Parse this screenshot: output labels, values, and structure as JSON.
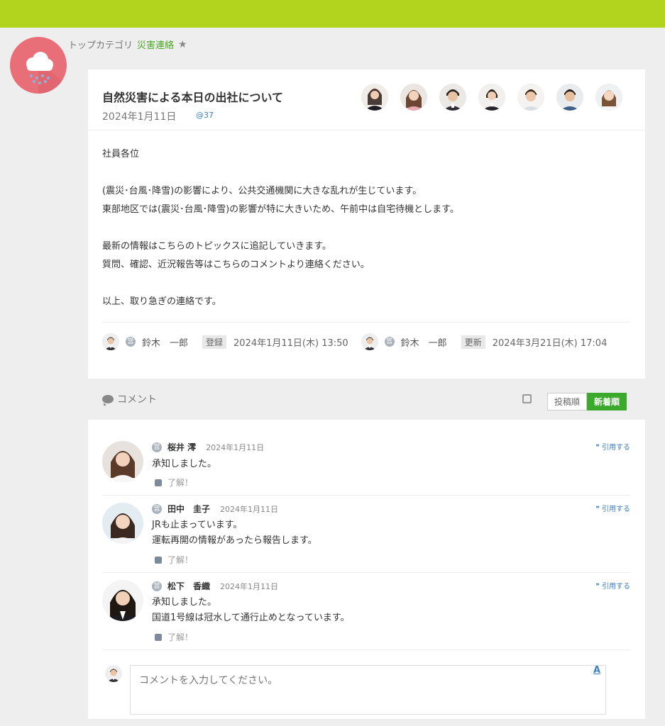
{
  "colors": {
    "topbar": "#b2d41f",
    "accent_green": "#3aa92c",
    "link_blue": "#3d7fc1",
    "category_icon": "#e86e78"
  },
  "breadcrumb": {
    "root": "トップカテゴリ",
    "current": "災害連絡",
    "star": "★"
  },
  "post": {
    "title": "自然災害による本日の出社について",
    "date": "2024年1月11日",
    "id": "@37",
    "body": {
      "salutation": "社員各位",
      "line1": "(震災･台風･降雪)の影響により、公共交通機関に大きな乱れが生じています。",
      "line2": "東部地区では(震災･台風･降雪)の影響が特に大きいため、午前中は自宅待機とします。",
      "line3": "最新の情報はこちらのトピックスに追記していきます。",
      "line4": "質問、確認、近況報告等はこちらのコメントより連絡ください。",
      "closing": "以上、取り急ぎの連絡です。"
    },
    "created": {
      "icon": "営",
      "name": "鈴木　一郎",
      "tag": "登録",
      "datetime": "2024年1月11日(木) 13:50"
    },
    "updated": {
      "icon": "営",
      "name": "鈴木　一郎",
      "tag": "更新",
      "datetime": "2024年3月21日(木) 17:04"
    }
  },
  "comments_section": {
    "label": "コメント",
    "sort_posted": "投稿順",
    "sort_newest": "新着順",
    "items": [
      {
        "icon": "営",
        "name": "桜井 澪",
        "date": "2024年1月11日",
        "lines": [
          "承知しました。"
        ],
        "like": "了解！",
        "quote": "引用する"
      },
      {
        "icon": "営",
        "name": "田中　圭子",
        "date": "2024年1月11日",
        "lines": [
          "JRも止まっています。",
          "運転再開の情報があったら報告します。"
        ],
        "like": "了解！",
        "quote": "引用する"
      },
      {
        "icon": "営",
        "name": "松下　香織",
        "date": "2024年1月11日",
        "lines": [
          "承知しました。",
          "国道1号線は冠水して通行止めとなっています。"
        ],
        "like": "了解！",
        "quote": "引用する"
      }
    ],
    "input_placeholder": "コメントを入力してください。",
    "format_button": "A"
  }
}
